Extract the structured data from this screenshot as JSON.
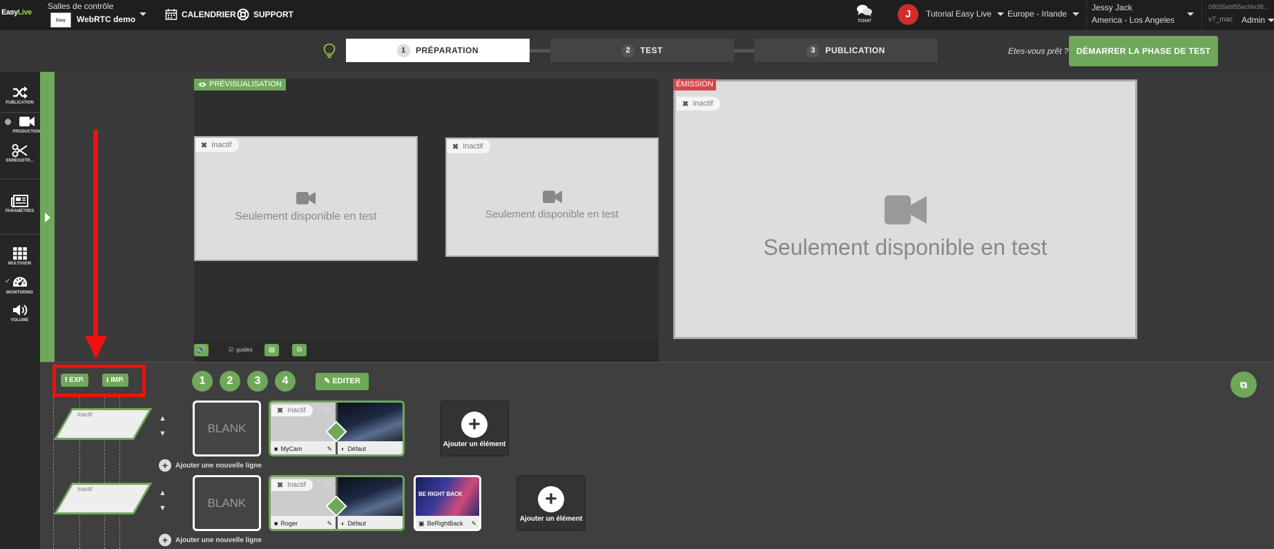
{
  "topbar": {
    "logo_a": "Easy",
    "logo_b": "Live",
    "salles_label": "Salles de contrôle",
    "room_thumb": "Easy",
    "room_name": "WebRTC demo",
    "calendrier": "CALENDRIER",
    "support": "SUPPORT",
    "tchat": "TCHAT",
    "avatar_initial": "J",
    "account": "Tutorial Easy Live",
    "region": "Europe - Irlande",
    "user_name": "Jessy Jack",
    "user_tz": "America - Los Angeles",
    "session_id": "08026ebf55ecf4e38...",
    "version": "v7_mac",
    "admin": "Admin"
  },
  "steps": [
    {
      "num": "1",
      "label": "PRÉPARATION",
      "active": true
    },
    {
      "num": "2",
      "label": "TEST",
      "active": false
    },
    {
      "num": "3",
      "label": "PUBLICATION",
      "active": false
    }
  ],
  "ready_text": "Etes-vous prêt ?",
  "start_button": "DÉMARRER LA PHASE DE TEST",
  "sidebar": {
    "items": [
      {
        "label": "PUBLICATION",
        "icon": "shuffle-icon"
      },
      {
        "label": "PRODUCTION",
        "icon": "video-camera-icon"
      },
      {
        "label": "ENREGISTR...",
        "icon": "scissors-icon"
      },
      {
        "label": "PARAMÈTRES",
        "icon": "newspaper-icon"
      },
      {
        "label": "MULTIVIEW",
        "icon": "grid-icon"
      },
      {
        "label": "MONITORING",
        "icon": "dashboard-icon"
      },
      {
        "label": "VOLUME",
        "icon": "volume-icon"
      }
    ]
  },
  "preview": {
    "label": "PRÉVISUALISATION",
    "inactive": "Inactif",
    "only_test": "Seulement disponible en test"
  },
  "emission": {
    "label": "ÉMISSION",
    "inactive": "Inactif",
    "only_test": "Seulement disponible en test"
  },
  "controls": {
    "guides": "guides"
  },
  "bottom": {
    "exp": "EXP.",
    "imp": "IMP.",
    "layout_numbers": [
      "1",
      "2",
      "3",
      "4"
    ],
    "edit": "EDITER",
    "blank": "BLANK",
    "add_element": "Ajouter un élément",
    "add_line": "Ajouter une nouvelle ligne",
    "inactive": "Inactif",
    "default": "Défaut",
    "row1_cam": "MyCam",
    "row2_cam": "Roger",
    "brb_title": "BE RIGHT BACK",
    "brb_label": "BeRightBack",
    "thumb_inactive": "Inactif"
  },
  "colors": {
    "accent_green": "#6fa85a",
    "emission_red": "#d9464a",
    "highlight_red": "#ee1111"
  }
}
